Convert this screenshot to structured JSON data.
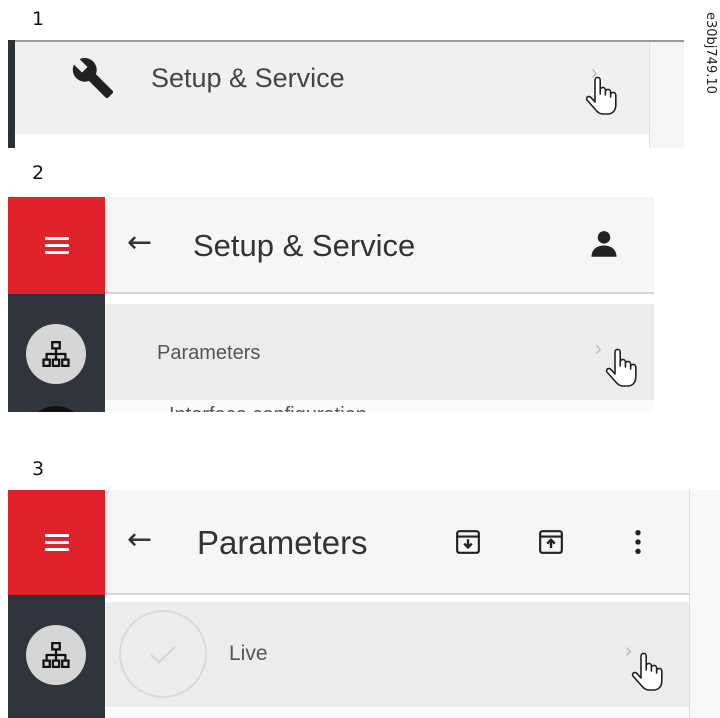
{
  "figure_id": "e30bj749.10",
  "steps": [
    {
      "number": "1",
      "menu_item": {
        "icon": "wrench-icon",
        "label": "Setup & Service"
      }
    },
    {
      "number": "2",
      "header": {
        "title": "Setup & Service",
        "back": "←",
        "user_icon": "user-icon"
      },
      "rail": {
        "menu_icon": "hamburger-icon",
        "items": [
          "network-icon"
        ]
      },
      "list": [
        {
          "label": "Parameters"
        },
        {
          "label": "Interface configuration"
        }
      ]
    },
    {
      "number": "3",
      "header": {
        "title": "Parameters",
        "back": "←",
        "actions": [
          "download-box-icon",
          "upload-box-icon",
          "more-vert-icon"
        ]
      },
      "rail": {
        "menu_icon": "hamburger-icon",
        "items": [
          "network-icon"
        ]
      },
      "list": [
        {
          "label": "Live",
          "status_icon": "check-circle-icon"
        }
      ]
    }
  ],
  "colors": {
    "accent_red": "#e0232a",
    "rail_dark": "#30353d",
    "row_bg": "#ececec"
  }
}
